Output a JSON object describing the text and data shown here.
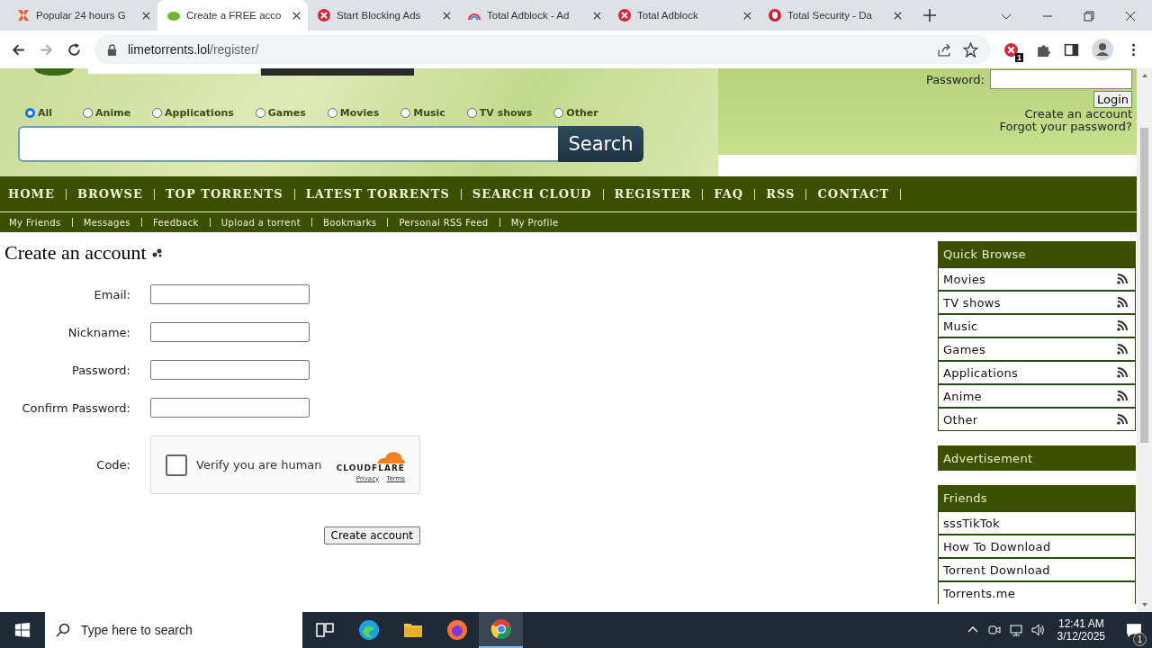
{
  "browser": {
    "tabs": [
      {
        "title": "Popular 24 hours G",
        "kind": "x",
        "selected": false
      },
      {
        "title": "Create a FREE acco",
        "kind": "lime",
        "selected": true
      },
      {
        "title": "Start Blocking Ads",
        "kind": "block",
        "selected": false
      },
      {
        "title": "Total Adblock - Ad",
        "kind": "rainbow",
        "selected": false
      },
      {
        "title": "Total Adblock",
        "kind": "block",
        "selected": false
      },
      {
        "title": "Total Security - Da",
        "kind": "shield",
        "selected": false
      }
    ],
    "url_host": "limetorrents.lol",
    "url_path": "/register/",
    "extension_badge": "1"
  },
  "header": {
    "categories": [
      {
        "label": "All",
        "selected": true
      },
      {
        "label": "Anime",
        "selected": false
      },
      {
        "label": "Applications",
        "selected": false
      },
      {
        "label": "Games",
        "selected": false
      },
      {
        "label": "Movies",
        "selected": false
      },
      {
        "label": "Music",
        "selected": false
      },
      {
        "label": "TV shows",
        "selected": false
      },
      {
        "label": "Other",
        "selected": false
      }
    ],
    "search_button": "Search",
    "password_label": "Password:",
    "login_button": "Login",
    "create_link": "Create an account",
    "forgot_link": "Forgot your password?"
  },
  "nav": [
    "HOME",
    "BROWSE",
    "TOP TORRENTS",
    "LATEST TORRENTS",
    "SEARCH CLOUD",
    "REGISTER",
    "FAQ",
    "RSS",
    "CONTACT"
  ],
  "subnav": [
    "My Friends",
    "Messages",
    "Feedback",
    "Upload a torrent",
    "Bookmarks",
    "Personal RSS Feed",
    "My Profile"
  ],
  "form": {
    "title": "Create an account",
    "fields": [
      "Email:",
      "Nickname:",
      "Password:",
      "Confirm Password:"
    ],
    "code_label": "Code:",
    "captcha": {
      "checked": false,
      "text": "Verify you are human",
      "brand": "CLOUDFLARE",
      "privacy": "Privacy",
      "separator": "·",
      "terms": "Terms"
    },
    "submit": "Create account"
  },
  "sidebar": {
    "quick_title": "Quick Browse",
    "quick_items": [
      "Movies",
      "TV shows",
      "Music",
      "Games",
      "Applications",
      "Anime",
      "Other"
    ],
    "ad_title": "Advertisement",
    "friends_title": "Friends",
    "friends": [
      "sssTikTok",
      "How To Download",
      "Torrent Download",
      "Torrents.me"
    ]
  },
  "taskbar": {
    "search_placeholder": "Type here to search",
    "apps": [
      {
        "kind": "taskview",
        "selected": false
      },
      {
        "kind": "edge",
        "selected": false
      },
      {
        "kind": "folder",
        "selected": false
      },
      {
        "kind": "firefox",
        "selected": false
      },
      {
        "kind": "chrome",
        "selected": true
      }
    ],
    "time": "12:41 AM",
    "date": "3/12/2025",
    "notifications": "1"
  }
}
